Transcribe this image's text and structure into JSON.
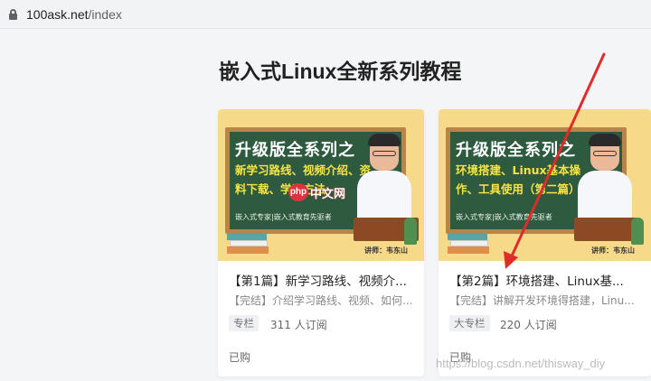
{
  "browser": {
    "url_domain": "100ask.net",
    "url_path": "/index"
  },
  "section_title": "嵌入式Linux全新系列教程",
  "cards": [
    {
      "thumb_title": "升级版全系列之",
      "thumb_sub": "新学习路线、视频介绍、资料下载、学习方法",
      "thumb_foot": "嵌入式专家|嵌入式教育先驱者",
      "lecturer": "讲师：韦东山",
      "title": "【第1篇】新学习路线、视频介...",
      "desc": "【完结】介绍学习路线、视频、如何...",
      "tag": "专栏",
      "subs": "311 人订阅",
      "status": "已购"
    },
    {
      "thumb_title": "升级版全系列之",
      "thumb_sub": "环境搭建、Linux基本操作、工具使用（第二篇）",
      "thumb_foot": "嵌入式专家|嵌入式教育先驱者",
      "lecturer": "讲师：韦东山",
      "title": "【第2篇】环境搭建、Linux基...",
      "desc": "【完结】讲解开发环境得搭建，Linu...",
      "tag": "大专栏",
      "subs": "220 人订阅",
      "status": "已购"
    }
  ],
  "watermark_logo": {
    "badge": "php",
    "text": "中文网"
  },
  "csdn_watermark": "https://blog.csdn.net/thisway_diy",
  "colors": {
    "arrow": "#e02b2b",
    "board": "#2e5a3f",
    "thumb_bg": "#f7d98a"
  }
}
